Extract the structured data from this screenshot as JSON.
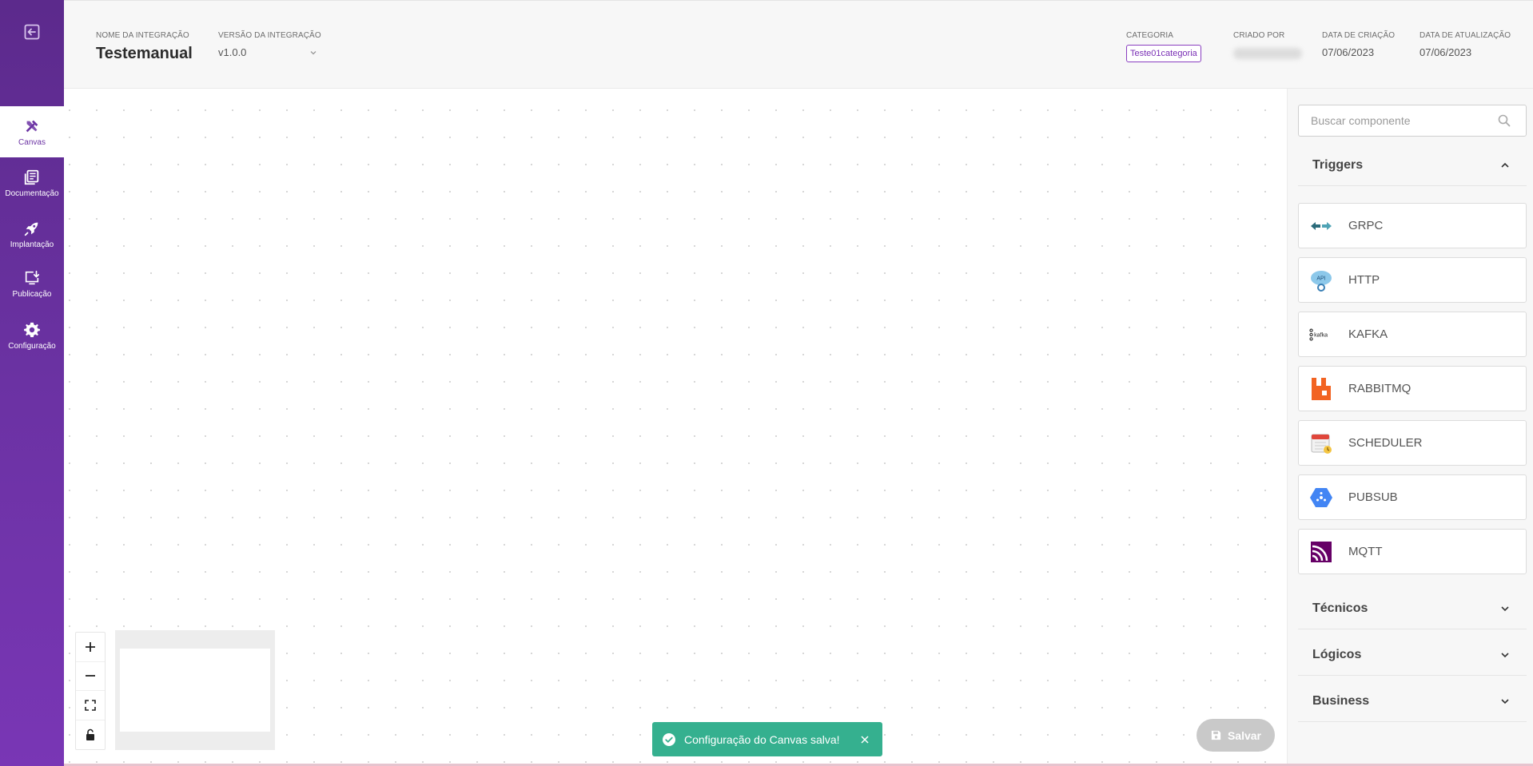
{
  "sidebar": {
    "exit_icon": "exit-icon",
    "items": [
      {
        "label": "Canvas",
        "icon": "canvas-tools-icon",
        "active": true
      },
      {
        "label": "Documentação",
        "icon": "document-icon",
        "active": false
      },
      {
        "label": "Implantação",
        "icon": "rocket-icon",
        "active": false
      },
      {
        "label": "Publicação",
        "icon": "publish-icon",
        "active": false
      },
      {
        "label": "Configuração",
        "icon": "gear-icon",
        "active": false
      }
    ]
  },
  "header": {
    "name_label": "NOME DA INTEGRAÇÃO",
    "name_value": "Testemanual",
    "version_label": "VERSÃO DA INTEGRAÇÃO",
    "version_value": "v1.0.0",
    "category_label": "CATEGORIA",
    "category_value": "Teste01categoria",
    "created_by_label": "CRIADO POR",
    "created_date_label": "DATA DE CRIAÇÃO",
    "created_date_value": "07/06/2023",
    "updated_date_label": "DATA DE ATUALIZAÇÃO",
    "updated_date_value": "07/06/2023"
  },
  "canvas": {
    "zoom_controls": [
      "zoom-in-icon",
      "zoom-out-icon",
      "fit-view-icon",
      "lock-icon"
    ]
  },
  "toast": {
    "message": "Configuração do Canvas salva!",
    "icon": "check-circle-icon",
    "close_icon": "close-icon"
  },
  "save_button": {
    "label": "Salvar",
    "icon": "floppy-disk-icon"
  },
  "right_panel": {
    "search_placeholder": "Buscar componente",
    "search_icon": "search-icon",
    "sections": [
      {
        "title": "Triggers",
        "expanded": true
      },
      {
        "title": "Técnicos",
        "expanded": false
      },
      {
        "title": "Lógicos",
        "expanded": false
      },
      {
        "title": "Business",
        "expanded": false
      }
    ],
    "triggers": [
      {
        "label": "GRPC",
        "icon": "grpc-icon"
      },
      {
        "label": "HTTP",
        "icon": "http-api-icon"
      },
      {
        "label": "KAFKA",
        "icon": "kafka-icon"
      },
      {
        "label": "RABBITMQ",
        "icon": "rabbitmq-icon"
      },
      {
        "label": "SCHEDULER",
        "icon": "scheduler-calendar-icon"
      },
      {
        "label": "PUBSUB",
        "icon": "pubsub-icon"
      },
      {
        "label": "MQTT",
        "icon": "mqtt-icon"
      }
    ]
  },
  "colors": {
    "sidebar_purple": "#6b32a3",
    "toast_green": "#35b08f",
    "category_purple": "#8a3fc0",
    "save_disabled": "#c9c9c9"
  }
}
